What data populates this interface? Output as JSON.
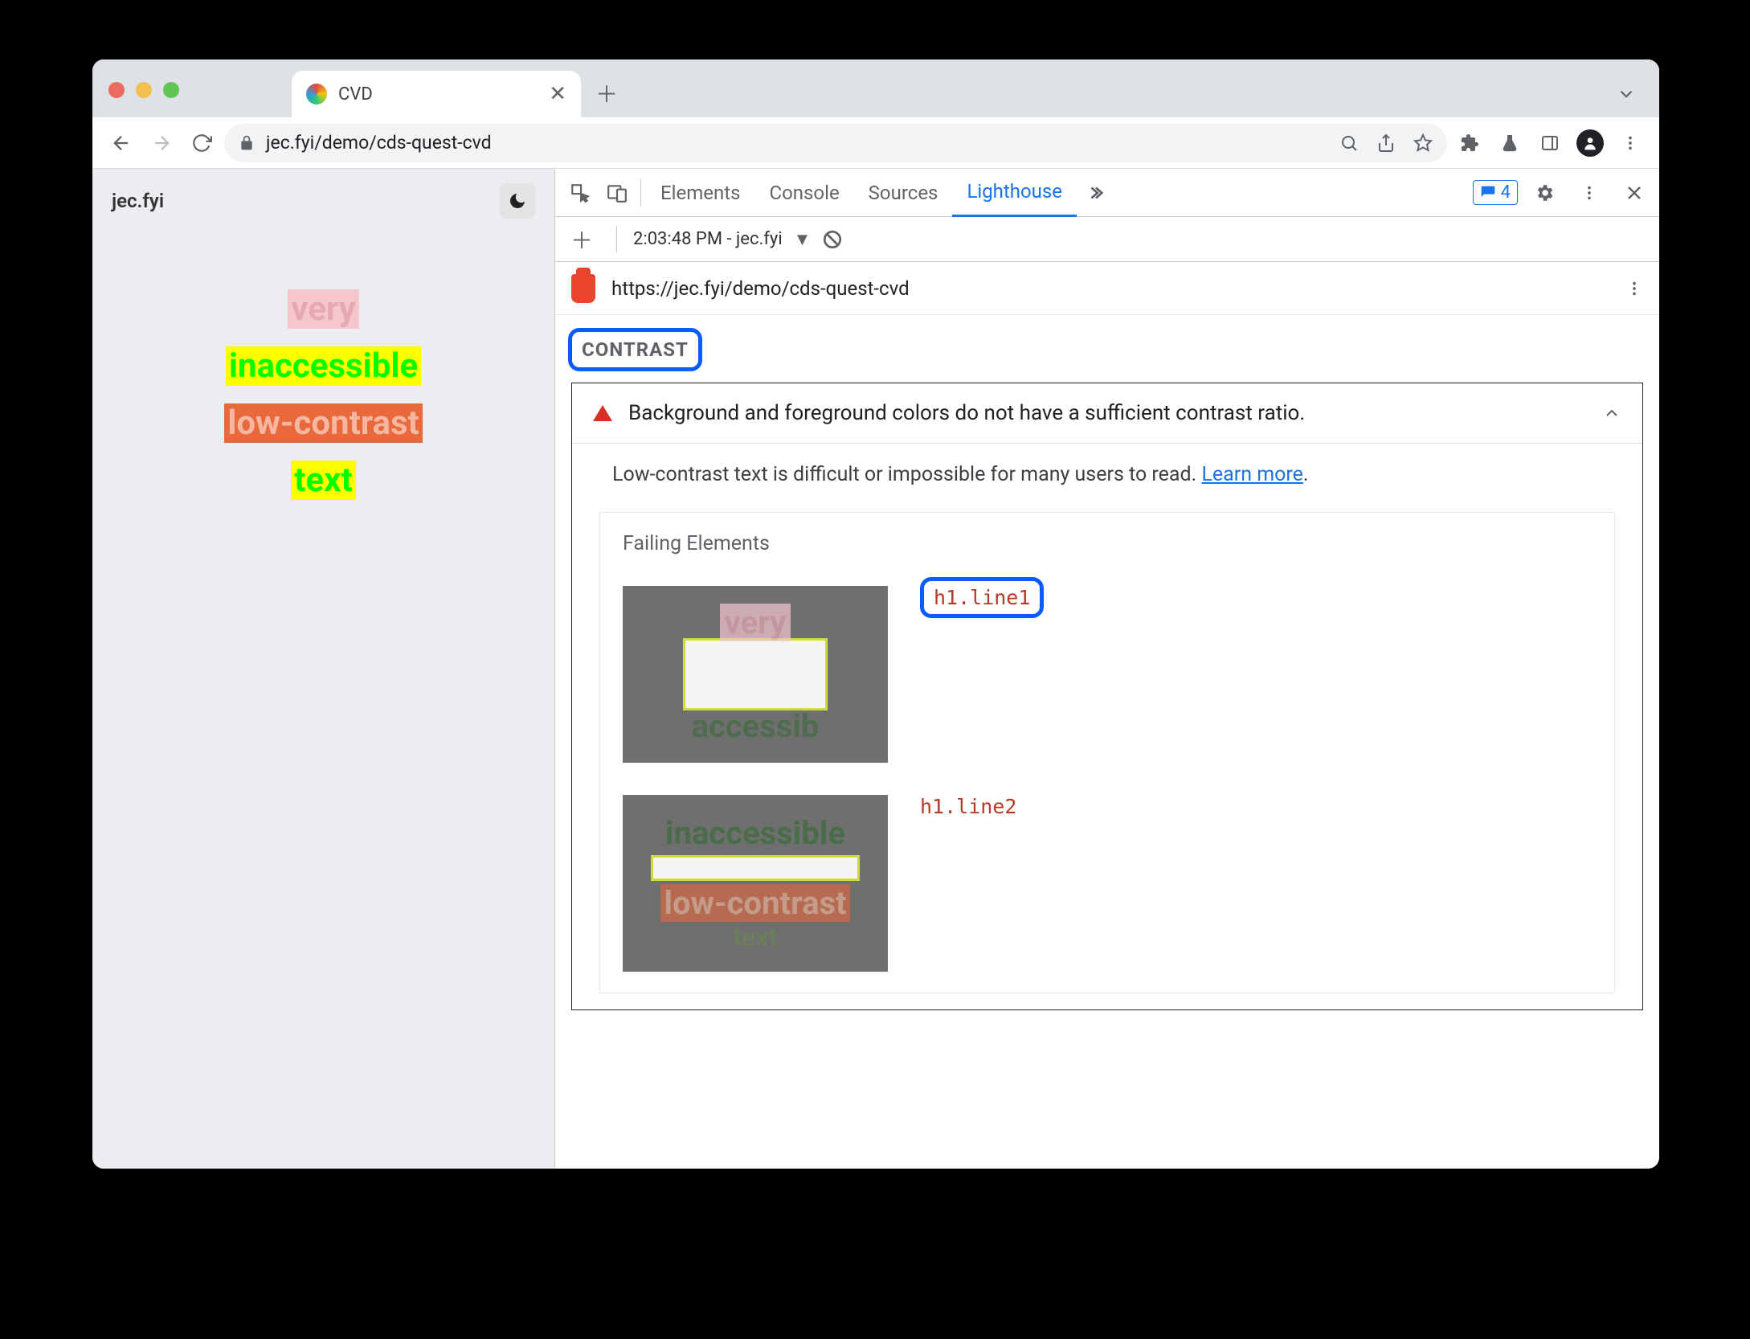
{
  "browser": {
    "tab_title": "CVD",
    "url": "jec.fyi/demo/cds-quest-cvd"
  },
  "page": {
    "site_title": "jec.fyi",
    "words": [
      "very",
      "inaccessible",
      "low-contrast",
      "text"
    ]
  },
  "devtools": {
    "tabs": {
      "elements": "Elements",
      "console": "Console",
      "sources": "Sources",
      "lighthouse": "Lighthouse"
    },
    "issues_count": "4",
    "report_time": "2:03:48 PM - jec.fyi",
    "report_url": "https://jec.fyi/demo/cds-quest-cvd",
    "section_label": "CONTRAST",
    "audit": {
      "title": "Background and foreground colors do not have a sufficient contrast ratio.",
      "description_pre": "Low-contrast text is difficult or impossible for many users to read. ",
      "learn_more": "Learn more",
      "description_post": ".",
      "failing_header": "Failing Elements",
      "items": [
        {
          "selector": "h1.line1"
        },
        {
          "selector": "h1.line2"
        }
      ]
    }
  }
}
